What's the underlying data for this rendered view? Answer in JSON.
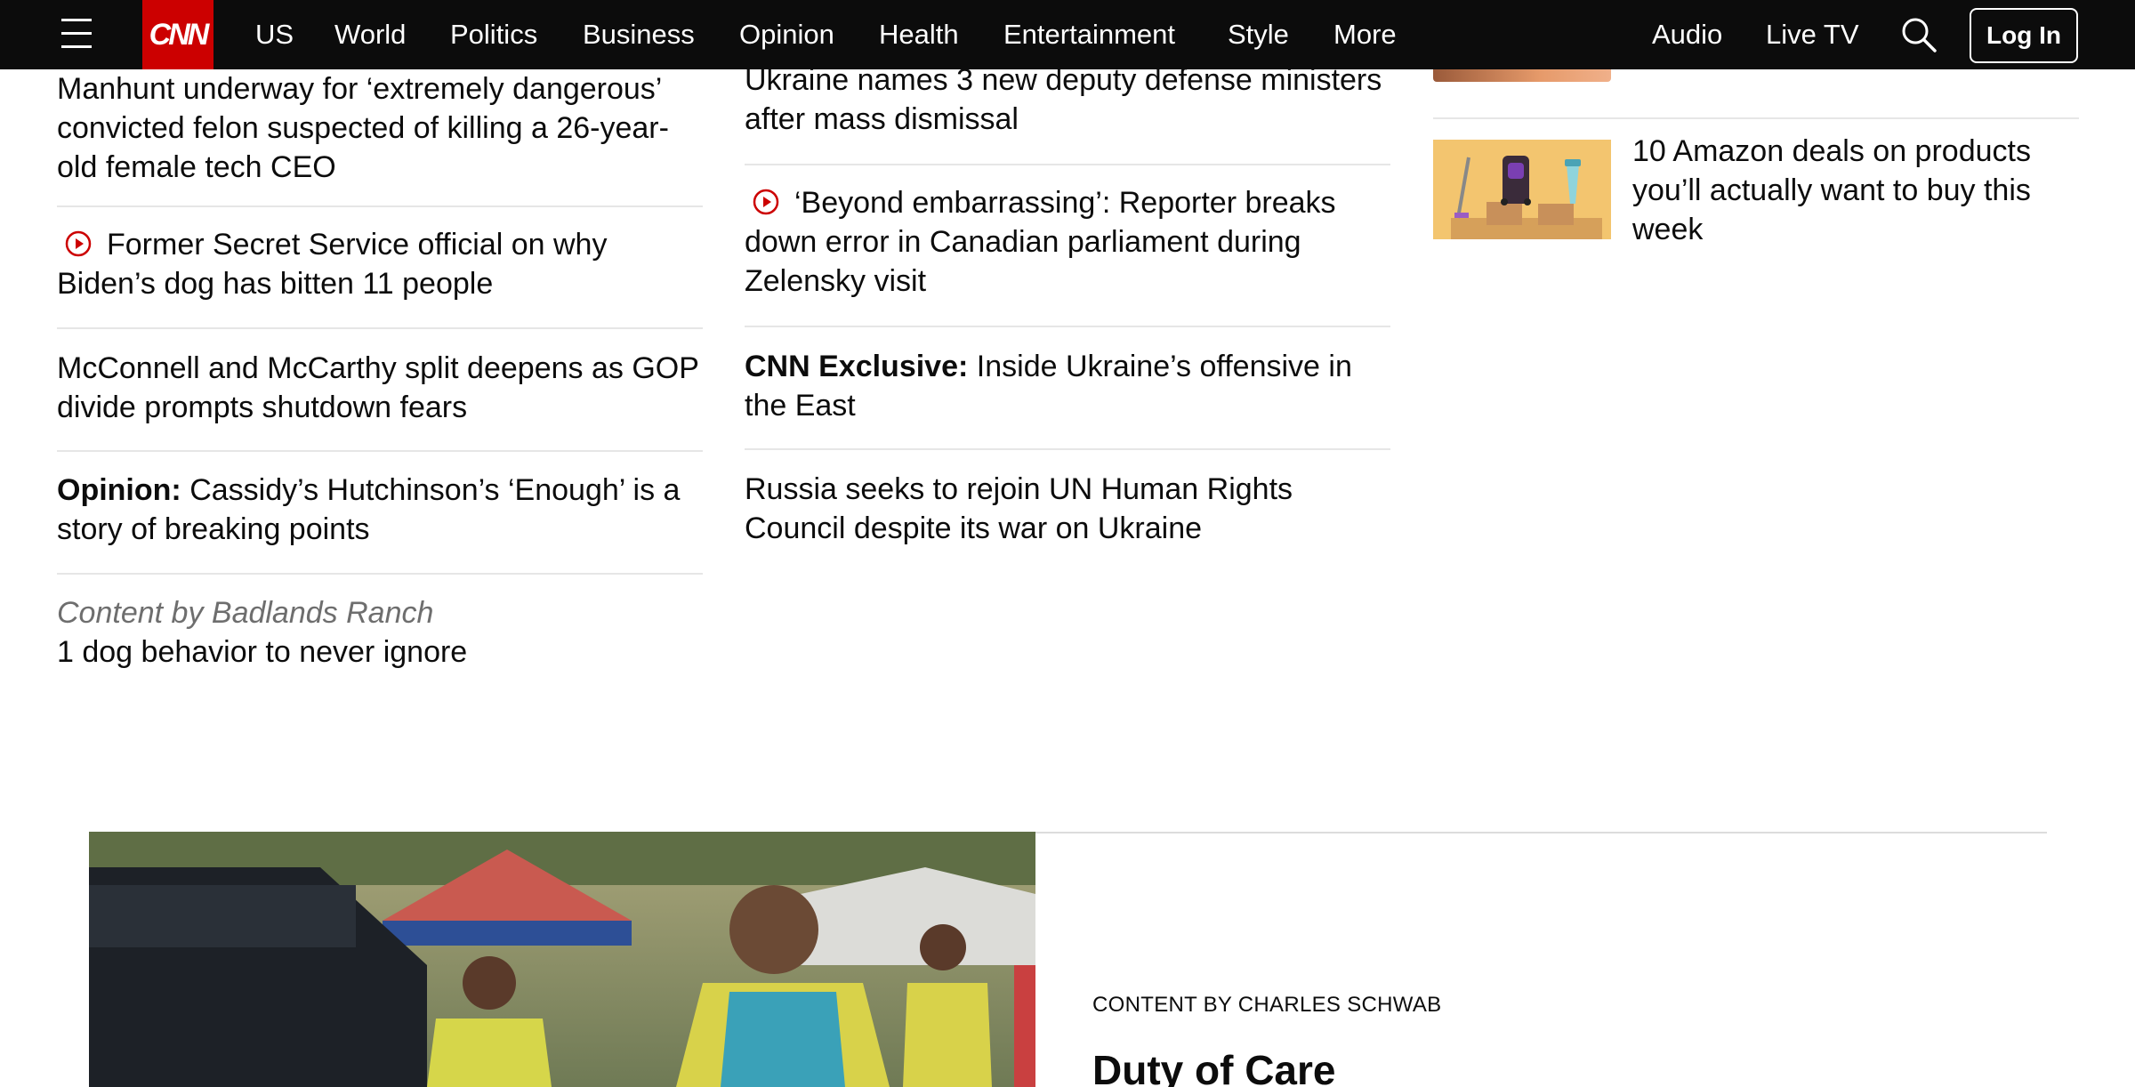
{
  "header": {
    "logo_text": "CNN",
    "nav": [
      "US",
      "World",
      "Politics",
      "Business",
      "Opinion",
      "Health",
      "Entertainment",
      "Style",
      "More"
    ],
    "right_nav": [
      "Audio",
      "Live TV"
    ],
    "login_label": "Log In",
    "brand_color": "#cc0000"
  },
  "left_column": {
    "items": [
      {
        "text": "Manhunt underway for ‘extremely dangerous’ convicted felon suspected of killing a 26-year-old female tech CEO"
      },
      {
        "video": true,
        "text": "Former Secret Service official on why Biden’s dog has bitten 11 people"
      },
      {
        "text": "McConnell and McCarthy split deepens as GOP divide prompts shutdown fears"
      },
      {
        "prefix": "Opinion:",
        "text": "Cassidy’s Hutchinson’s ‘Enough’ is a story of breaking points"
      }
    ],
    "sponsored": {
      "label": "Content by Badlands Ranch",
      "text": "1 dog behavior to never ignore"
    }
  },
  "middle_column": {
    "items": [
      {
        "text": "Ukraine names 3 new deputy defense ministers after mass dismissal"
      },
      {
        "video": true,
        "text": "‘Beyond embarrassing’: Reporter breaks down error in Canadian parliament during Zelensky visit"
      },
      {
        "prefix": "CNN Exclusive:",
        "text": "Inside Ukraine’s offensive in the East"
      },
      {
        "text": "Russia seeks to rejoin UN Human Rights Council despite its war on Ukraine"
      }
    ]
  },
  "right_column": {
    "deal_title": "10 Amazon deals on products you’ll actually want to buy this week"
  },
  "feature": {
    "kicker": "CONTENT BY CHARLES SCHWAB",
    "title": "Duty of Care"
  },
  "icons": {
    "menu": "hamburger-menu-icon",
    "search": "search-icon",
    "play": "play-circle-icon"
  }
}
